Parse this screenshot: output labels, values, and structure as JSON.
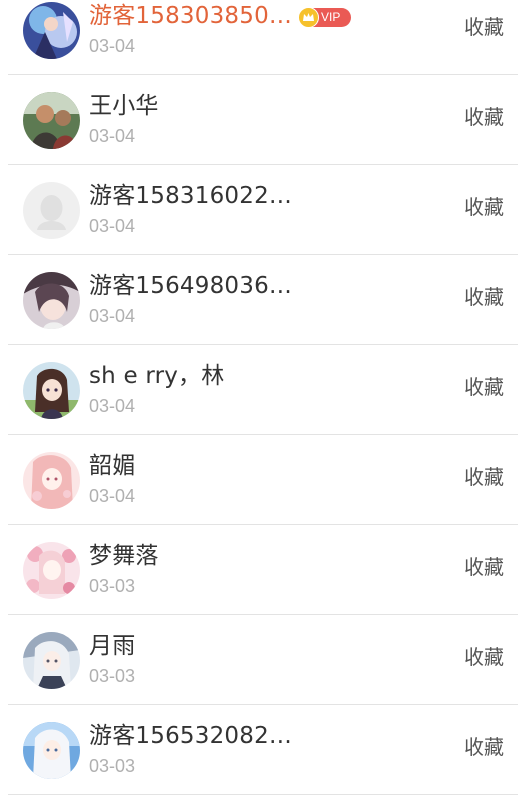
{
  "users": [
    {
      "name": "游客158303850…",
      "date": "03-04",
      "action": "收藏",
      "vip": true,
      "vip_label": "VIP",
      "avatar": "anime-blue-character-avatar"
    },
    {
      "name": "王小华",
      "date": "03-04",
      "action": "收藏",
      "vip": false,
      "avatar": "photo-man-avatar"
    },
    {
      "name": "游客158316022…",
      "date": "03-04",
      "action": "收藏",
      "vip": false,
      "avatar": "default-placeholder-avatar"
    },
    {
      "name": "游客156498036…",
      "date": "03-04",
      "action": "收藏",
      "vip": false,
      "avatar": "girl-photo-avatar"
    },
    {
      "name": "sh e rry，林",
      "date": "03-04",
      "action": "收藏",
      "vip": false,
      "avatar": "anime-girl-avatar"
    },
    {
      "name": "韶媚",
      "date": "03-04",
      "action": "收藏",
      "vip": false,
      "avatar": "pink-anime-avatar"
    },
    {
      "name": "梦舞落",
      "date": "03-03",
      "action": "收藏",
      "vip": false,
      "avatar": "pink-floral-anime-avatar"
    },
    {
      "name": "月雨",
      "date": "03-03",
      "action": "收藏",
      "vip": false,
      "avatar": "anime-white-hair-avatar"
    },
    {
      "name": "游客156532082…",
      "date": "03-03",
      "action": "收藏",
      "vip": false,
      "avatar": "anime-blue-sky-avatar"
    }
  ],
  "colors": {
    "vip_name": "#e2643a",
    "name": "#333333",
    "date": "#b0b0b0",
    "action": "#555555",
    "vip_badge": "#ea5a54",
    "crown": "#f6c12c"
  }
}
